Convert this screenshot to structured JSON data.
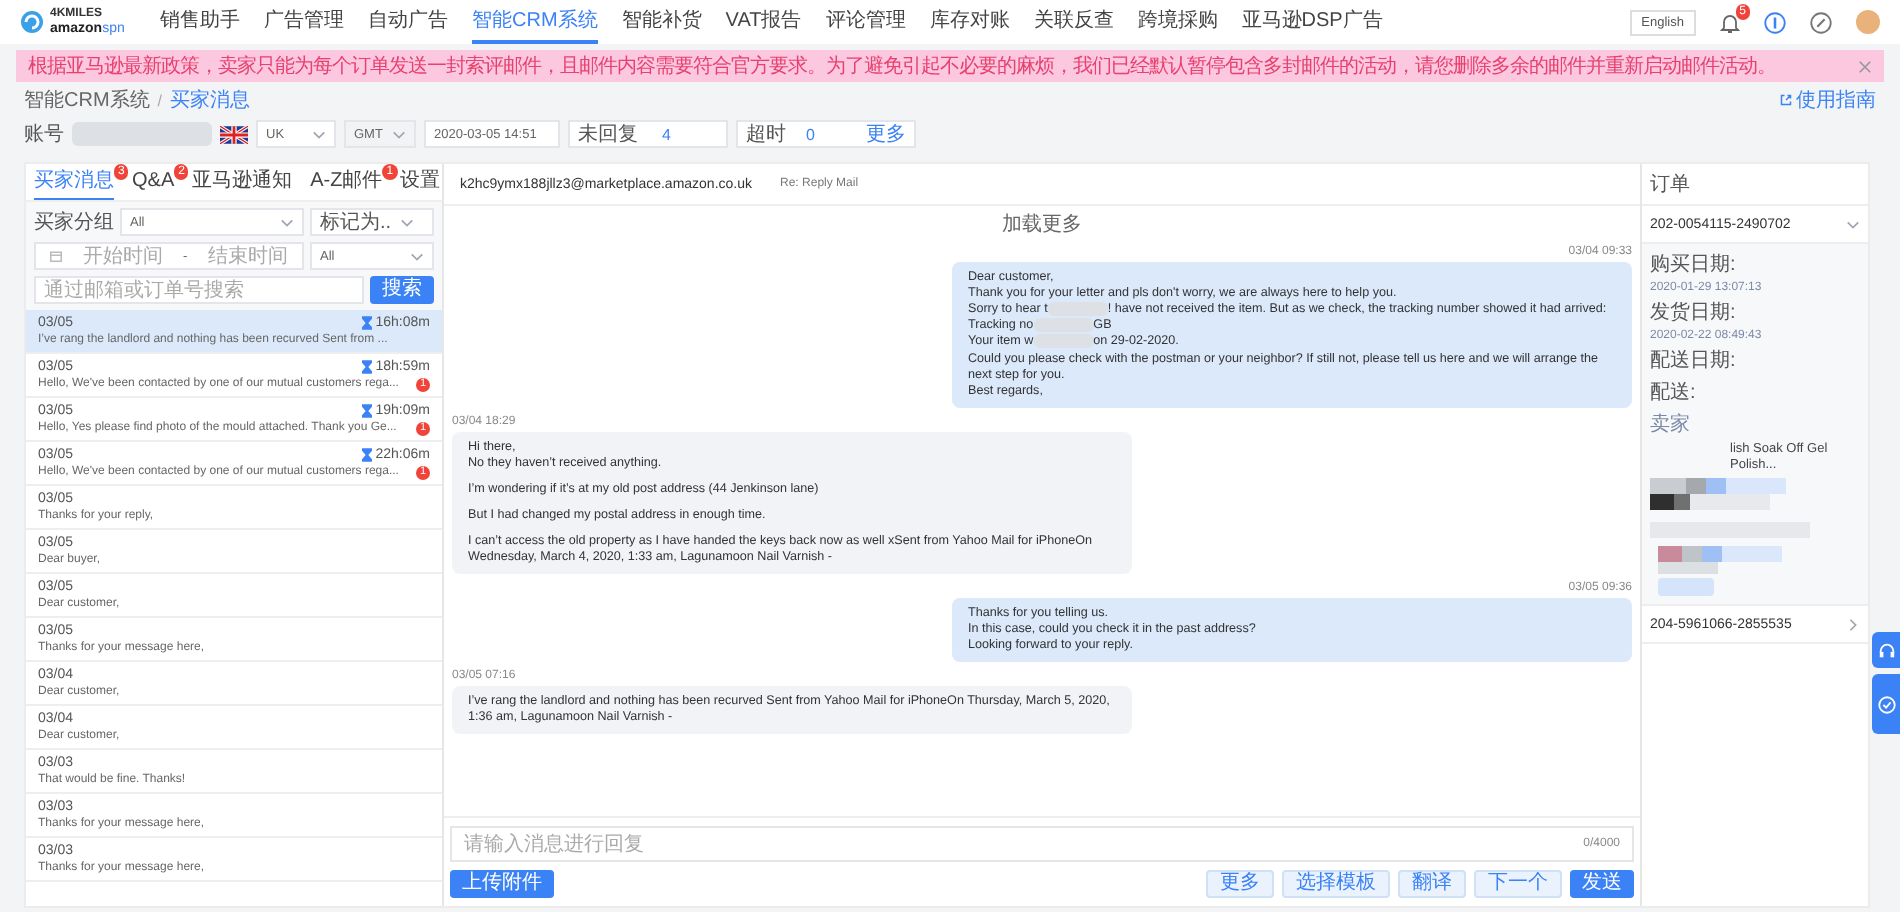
{
  "nav": {
    "logo": {
      "brand": "4KMILES",
      "sub": "amazon",
      "suffix": "spn"
    },
    "items": [
      {
        "label": "销售助手",
        "selected": false
      },
      {
        "label": "广告管理",
        "selected": false
      },
      {
        "label": "自动广告",
        "selected": false
      },
      {
        "label": "智能CRM系统",
        "selected": true
      },
      {
        "label": "智能补货",
        "selected": false
      },
      {
        "label": "VAT报告",
        "selected": false
      },
      {
        "label": "评论管理",
        "selected": false
      },
      {
        "label": "库存对账",
        "selected": false
      },
      {
        "label": "关联反查",
        "selected": false
      },
      {
        "label": "跨境採购",
        "selected": false
      },
      {
        "label": "亚马逊DSP广告",
        "selected": false
      }
    ],
    "language_button": "English",
    "notification_badge": "5"
  },
  "banner": {
    "text": "根据亚马逊最新政策，卖家只能为每个订单发送一封索评邮件，且邮件内容需要符合官方要求。为了避免引起不必要的麻烦，我们已经默认暂停包含多封邮件的活动，请您删除多余的邮件并重新启动邮件活动。"
  },
  "breadcrumb": [
    "智能CRM系统",
    "/",
    "买家消息"
  ],
  "help_link": "使用指南",
  "filters": {
    "account_label": "账号",
    "marketplace": "UK",
    "timezone": "GMT",
    "datetime": "2020-03-05 14:51",
    "unreplied_label": "未回复",
    "unreplied_count": "4",
    "overdue_label": "超时",
    "overdue_count": "0",
    "more": "更多"
  },
  "tabs": [
    {
      "label": "买家消息",
      "badge": "3",
      "selected": true
    },
    {
      "label": "Q&A",
      "badge": "2",
      "selected": false
    },
    {
      "label": "亚马逊通知",
      "selected": false
    },
    {
      "label": "A-Z邮件",
      "badge": "1",
      "selected": false
    },
    {
      "label": "设置",
      "selected": false
    }
  ],
  "list_filters": {
    "group_label": "买家分组",
    "group_value": "All",
    "mark_value": "标记为..",
    "start_placeholder": "开始时间",
    "date_separator": "-",
    "end_placeholder": "结束时间",
    "status_value": "All",
    "search_placeholder": "通过邮箱或订单号搜索",
    "search_button": "搜索"
  },
  "conversations": [
    {
      "date": "03/05",
      "timer": "16h:08m",
      "preview": "I’ve rang the landlord and nothing has been recurved Sent from ...",
      "selected": true
    },
    {
      "date": "03/05",
      "timer": "18h:59m",
      "preview": "Hello, We've been contacted by one of our mutual customers rega...",
      "unread_badge": "1",
      "selected": false
    },
    {
      "date": "03/05",
      "timer": "19h:09m",
      "preview": "Hello, Yes please find photo of the mould attached. Thank you  Ge...",
      "unread_badge": "1",
      "selected": false
    },
    {
      "date": "03/05",
      "timer": "22h:06m",
      "preview": "Hello, We've been contacted by one of our mutual customers rega...",
      "unread_badge": "1",
      "selected": false
    },
    {
      "date": "03/05",
      "preview": "Thanks for your reply,",
      "selected": false
    },
    {
      "date": "03/05",
      "preview": "Dear buyer,",
      "selected": false
    },
    {
      "date": "03/05",
      "preview": "Dear customer,",
      "selected": false
    },
    {
      "date": "03/05",
      "preview": "Thanks for your message here,",
      "selected": false
    },
    {
      "date": "03/04",
      "preview": "Dear customer,",
      "selected": false
    },
    {
      "date": "03/04",
      "preview": "Dear customer,",
      "selected": false
    },
    {
      "date": "03/03",
      "preview": "That would be fine. Thanks!",
      "selected": false
    },
    {
      "date": "03/03",
      "preview": "Thanks for your message here,",
      "selected": false
    },
    {
      "date": "03/03",
      "preview": "Thanks for your message here,",
      "selected": false
    }
  ],
  "thread": {
    "email": "k2hc9ymx188jllz3@marketplace.amazon.co.uk",
    "subject": "Re: Reply Mail",
    "load_more": "加载更多",
    "messages": [
      {
        "kind": "outgoing",
        "time": "03/04 09:33",
        "paragraphs": [
          [
            [
              "Dear customer,"
            ],
            [
              "Thank you for your letter and pls don't worry, we are always here to help you."
            ],
            [
              "Sorry to hear t",
              "! have not received the item. But as we check, the tracking number showed it had arrived:"
            ],
            [
              "Tracking no",
              "GB"
            ],
            [
              "Your item w",
              "on 29-02-2020."
            ],
            [
              "Could  you please check with the postman or your neighbor? If still not, please tell us here and we will arrange the next step for you."
            ],
            [
              "Best regards,"
            ]
          ]
        ]
      },
      {
        "kind": "incoming",
        "time": "03/04 18:29",
        "paragraphs": [
          [
            [
              "Hi there,"
            ],
            [
              "No they haven’t received anything."
            ]
          ],
          [
            [
              "I’m wondering if it’s at my old post address (44 Jenkinson lane)"
            ]
          ],
          [
            [
              "But I had changed my postal address in enough time."
            ]
          ],
          [
            [
              "I can’t access the old property as I have handed the keys back now as well xSent from Yahoo Mail for iPhoneOn Wednesday, March 4, 2020, 1:33 am, Lagunamoon Nail Varnish -"
            ]
          ]
        ]
      },
      {
        "kind": "outgoing",
        "time": "03/05 09:36",
        "paragraphs": [
          [
            [
              "Thanks for you telling us."
            ],
            [
              "In this case, could you check it in the past address?"
            ],
            [
              "Looking forward to your reply."
            ]
          ]
        ]
      },
      {
        "kind": "incoming",
        "time": "03/05 07:16",
        "paragraphs": [
          [
            [
              "I’ve rang the landlord and nothing has been recurved Sent from Yahoo Mail for iPhoneOn Thursday, March 5, 2020, 1:36 am, Lagunamoon Nail Varnish -"
            ]
          ]
        ]
      }
    ]
  },
  "composer": {
    "placeholder": "请输入消息进行回复",
    "counter": "0/4000",
    "upload_button": "上传附件",
    "actions": [
      "更多",
      "选择模板",
      "翻译",
      "下一个"
    ],
    "send_button": "发送"
  },
  "orders": {
    "title": "订单",
    "items": [
      {
        "number": "202-0054115-2490702",
        "expanded": true,
        "fields": [
          {
            "label": "购买日期:",
            "value": "2020-01-29 13:07:13"
          },
          {
            "label": "发货日期:",
            "value": "2020-02-22 08:49:43"
          },
          {
            "label": "配送日期:"
          },
          {
            "label": "配送:",
            "value": "卖家"
          }
        ],
        "product_title": "lish Soak Off Gel Polish..."
      },
      {
        "number": "204-5961066-2855535",
        "expanded": false
      }
    ]
  }
}
